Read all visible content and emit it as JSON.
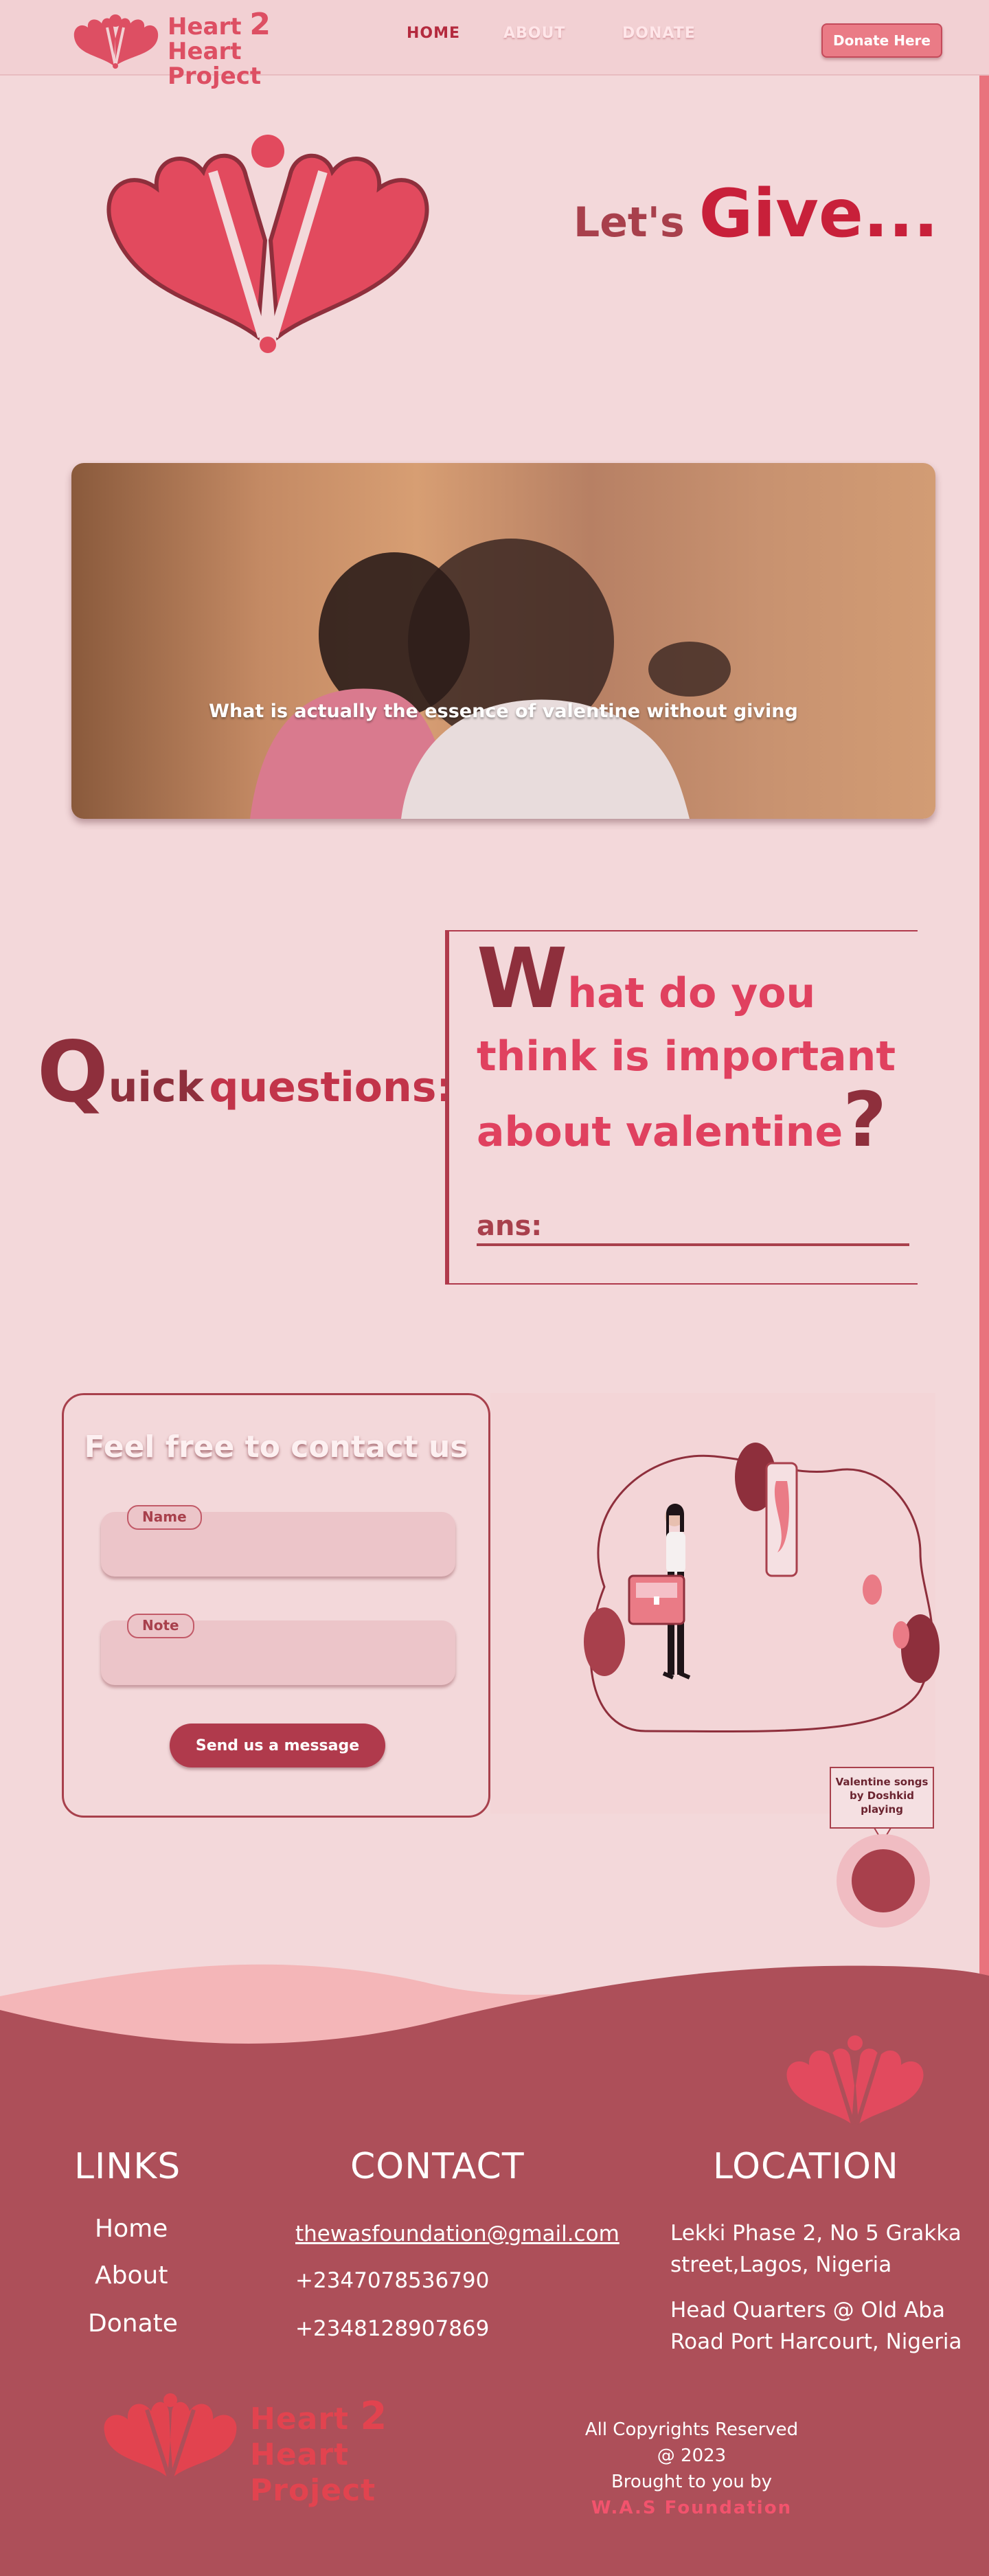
{
  "header": {
    "brand_line1_a": "Heart ",
    "brand_num": "2",
    "brand_line1_b": " Heart",
    "brand_line2": "Project",
    "nav": {
      "home": "HOME",
      "about": "ABOUT",
      "donate": "DONATE"
    },
    "donate_button": "Donate Here"
  },
  "hero": {
    "title_small": "Let's ",
    "title_big": "Give...",
    "banner_caption": "What is actually the essence of valentine without giving"
  },
  "quick": {
    "q_big": "Q",
    "q_rest": "uick",
    "q_word": "questions:",
    "question_big_w": "W",
    "question_text": "hat do you think is important about valentine",
    "question_mark": "?",
    "ans_label": "ans:"
  },
  "contact": {
    "title": "Feel free to contact us",
    "name_tag": "Name",
    "note_tag": "Note",
    "send_button": "Send us a message",
    "music_label": "Valentine songs by Doshkid  playing"
  },
  "footer": {
    "links_heading": "LINKS",
    "contact_heading": "CONTACT",
    "location_heading": "LOCATION",
    "links": [
      "Home",
      "About",
      "Donate"
    ],
    "email": "thewasfoundation@gmail.com",
    "phone1": "+2347078536790",
    "phone2": "+2348128907869",
    "address1_a": "Lekki Phase 2, No 5 Grakka",
    "address1_b": "street,Lagos, Nigeria",
    "address2_a": "Head Quarters @ Old Aba",
    "address2_b": "Road Port Harcourt, Nigeria",
    "copyright": "All Copyrights Reserved @ 2023",
    "brought": "Brought to you by",
    "org": "W.A.S Foundation",
    "brand_line1_a": "Heart ",
    "brand_num": "2",
    "brand_line1_b": " Heart",
    "brand_line2": "Project"
  },
  "colors": {
    "background": "#f3d8da",
    "accent": "#e0415f",
    "dark_accent": "#a8404c",
    "footer": "#ad4f59"
  }
}
